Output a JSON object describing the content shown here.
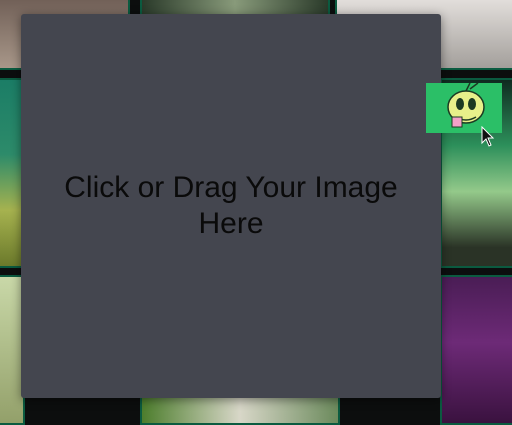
{
  "dropzone": {
    "label": "Click or Drag Your Image Here"
  },
  "dragged_item": {
    "icon": "image-thumbnail-icon"
  },
  "colors": {
    "modal_bg": "#44464f",
    "thumbnail_bg": "#2bbf67",
    "grid_border": "#0b5b40"
  }
}
